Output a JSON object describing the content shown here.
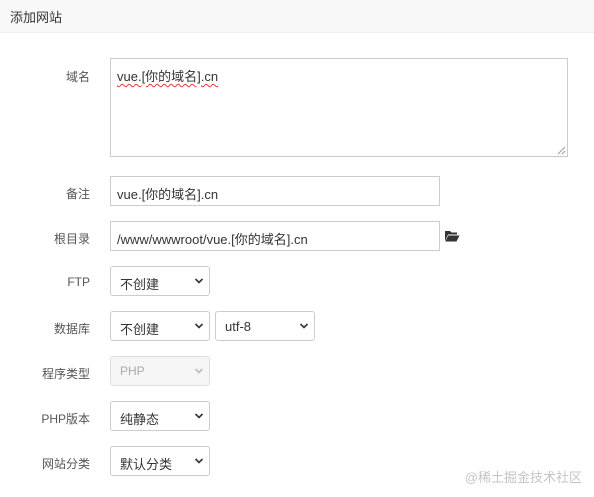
{
  "header": {
    "title": "添加网站"
  },
  "form": {
    "domain": {
      "label": "域名",
      "value": "vue.[你的域名].cn"
    },
    "remark": {
      "label": "备注",
      "value": "vue.[你的域名].cn"
    },
    "root_dir": {
      "label": "根目录",
      "value": "/www/wwwroot/vue.[你的域名].cn",
      "icon": "folder-open-icon"
    },
    "ftp": {
      "label": "FTP",
      "value": "不创建"
    },
    "database": {
      "label": "数据库",
      "value": "不创建",
      "charset": "utf-8"
    },
    "program_type": {
      "label": "程序类型",
      "value": "PHP",
      "disabled": true
    },
    "php_version": {
      "label": "PHP版本",
      "value": "纯静态"
    },
    "site_category": {
      "label": "网站分类",
      "value": "默认分类"
    }
  },
  "watermark": "@稀土掘金技术社区",
  "colors": {
    "border": "#cccccc",
    "header_bg": "#f8f8f8",
    "spellcheck_underline": "#e53935",
    "watermark": "#c4c4c4"
  }
}
